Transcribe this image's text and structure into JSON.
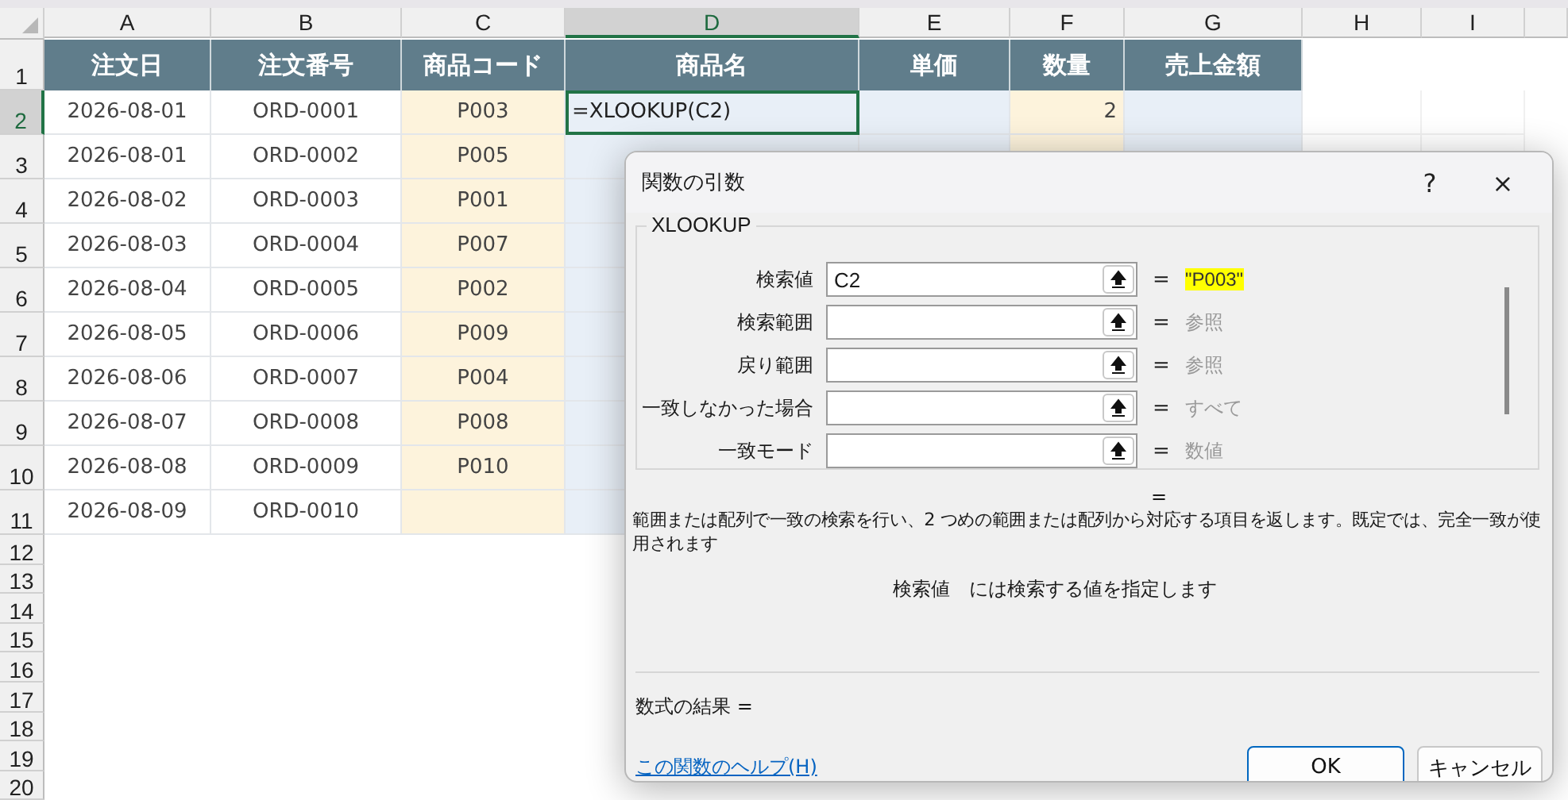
{
  "columns": [
    {
      "label": "A",
      "selected": false
    },
    {
      "label": "B",
      "selected": false
    },
    {
      "label": "C",
      "selected": false
    },
    {
      "label": "D",
      "selected": true
    },
    {
      "label": "E",
      "selected": false
    },
    {
      "label": "F",
      "selected": false
    },
    {
      "label": "G",
      "selected": false
    },
    {
      "label": "H",
      "selected": false
    },
    {
      "label": "I",
      "selected": false
    }
  ],
  "header_row": {
    "number": "1",
    "cells": [
      "注文日",
      "注文番号",
      "商品コード",
      "商品名",
      "単価",
      "数量",
      "売上金額"
    ]
  },
  "rows": [
    {
      "number": "2",
      "selected": true,
      "cells": [
        "2026-08-01",
        "ORD-0001",
        "P003",
        "=XLOOKUP(C2)",
        "",
        "2",
        ""
      ]
    },
    {
      "number": "3",
      "selected": false,
      "cells": [
        "2026-08-01",
        "ORD-0002",
        "P005",
        "",
        "",
        "",
        ""
      ]
    },
    {
      "number": "4",
      "selected": false,
      "cells": [
        "2026-08-02",
        "ORD-0003",
        "P001",
        "",
        "",
        "",
        ""
      ]
    },
    {
      "number": "5",
      "selected": false,
      "cells": [
        "2026-08-03",
        "ORD-0004",
        "P007",
        "",
        "",
        "",
        ""
      ]
    },
    {
      "number": "6",
      "selected": false,
      "cells": [
        "2026-08-04",
        "ORD-0005",
        "P002",
        "",
        "",
        "",
        ""
      ]
    },
    {
      "number": "7",
      "selected": false,
      "cells": [
        "2026-08-05",
        "ORD-0006",
        "P009",
        "",
        "",
        "",
        ""
      ]
    },
    {
      "number": "8",
      "selected": false,
      "cells": [
        "2026-08-06",
        "ORD-0007",
        "P004",
        "",
        "",
        "",
        ""
      ]
    },
    {
      "number": "9",
      "selected": false,
      "cells": [
        "2026-08-07",
        "ORD-0008",
        "P008",
        "",
        "",
        "",
        ""
      ]
    },
    {
      "number": "10",
      "selected": false,
      "cells": [
        "2026-08-08",
        "ORD-0009",
        "P010",
        "",
        "",
        "",
        ""
      ]
    },
    {
      "number": "11",
      "selected": false,
      "cells": [
        "2026-08-09",
        "ORD-0010",
        "",
        "",
        "",
        "",
        ""
      ]
    }
  ],
  "empty_rows": [
    "12",
    "13",
    "14",
    "15",
    "16",
    "17",
    "18",
    "19",
    "20"
  ],
  "dialog": {
    "title": "関数の引数",
    "help": "?",
    "close": "×",
    "function_name": "XLOOKUP",
    "arguments": [
      {
        "label": "検索値",
        "value": "C2",
        "equals": "=",
        "result": "\"P003\"",
        "kind": "value"
      },
      {
        "label": "検索範囲",
        "equals": "=",
        "result": "参照",
        "kind": "hint"
      },
      {
        "label": "戻り範囲",
        "equals": "=",
        "result": "参照",
        "kind": "hint"
      },
      {
        "label": "一致しなかった場合",
        "equals": "=",
        "result": "すべて",
        "kind": "hint"
      },
      {
        "label": "一致モード",
        "equals": "=",
        "result": "数値",
        "kind": "hint"
      }
    ],
    "overall_equals": "=",
    "description": "範囲または配列で一致の検索を行い、2 つめの範囲または配列から対応する項目を返します。既定では、完全一致が使用されます",
    "argument_help": {
      "name": "検索値",
      "text": "には検索する値を指定します"
    },
    "formula_result": "数式の結果 =",
    "help_link": "この関数のヘルプ(H)",
    "buttons": [
      {
        "label": "OK",
        "kind": "primary"
      },
      {
        "label": "キャンセル",
        "kind": "secondary"
      }
    ]
  }
}
